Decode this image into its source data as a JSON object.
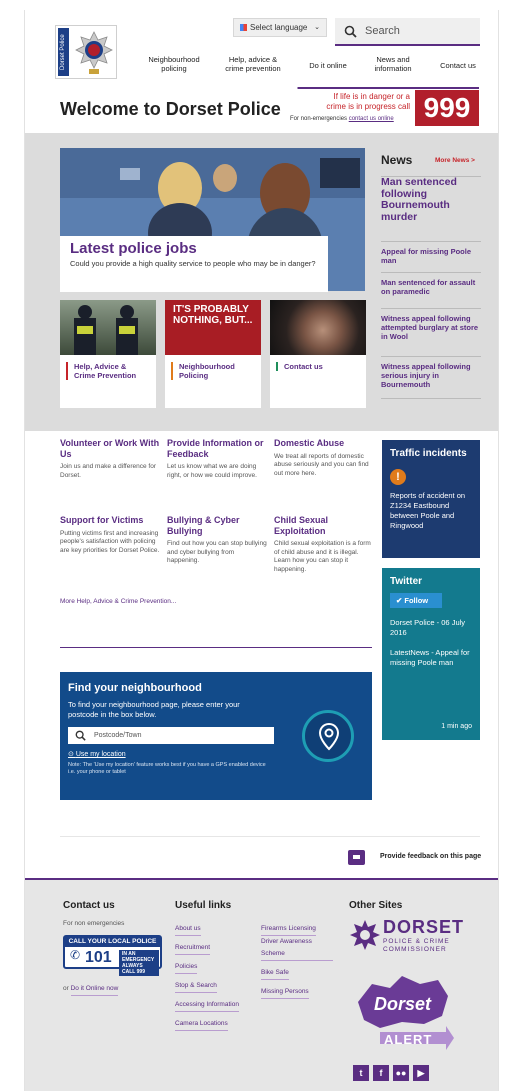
{
  "header": {
    "logo_text": "Dorset Police",
    "language_label": "Select language",
    "search_placeholder": "Search",
    "nav": [
      {
        "label_1": "Neighbourhood",
        "label_2": "policing"
      },
      {
        "label_1": "Help, advice &",
        "label_2": "crime prevention"
      },
      {
        "label_1": "Do it online",
        "label_2": ""
      },
      {
        "label_1": "News and",
        "label_2": "information"
      },
      {
        "label_1": "Contact us",
        "label_2": ""
      }
    ],
    "title": "Welcome to Dorset Police",
    "emergency_line1": "If life is in danger or a",
    "emergency_line2": "crime is in progress call",
    "non_emergency_prefix": "For non-emergencies",
    "non_emergency_link": "contact us online",
    "emergency_number": "999"
  },
  "hero": {
    "title": "Latest police jobs",
    "text": "Could you provide a high quality service to people who may be in danger?"
  },
  "tiles": [
    {
      "label": "Help, Advice & Crime Prevention",
      "accent": "#c6242a"
    },
    {
      "label": "Neighbourhood Policing",
      "image_text": "IT'S PROBABLY NOTHING, BUT...",
      "accent": "#e07b1b"
    },
    {
      "label": "Contact us",
      "accent": "#1f8f5b"
    }
  ],
  "news": {
    "heading": "News",
    "more_label": "More News >",
    "items": [
      "Man sentenced following Bournemouth murder",
      "Appeal for missing Poole man",
      "Man sentenced for assault on paramedic",
      "Witness appeal following attempted burglary at store in Wool",
      "Witness appeal following serious injury in Bournemouth"
    ]
  },
  "links": [
    {
      "title": "Volunteer or Work With Us",
      "text": "Join us and make a difference for Dorset."
    },
    {
      "title": "Provide Information or Feedback",
      "text": "Let us know what we are doing right, or how we could improve."
    },
    {
      "title": "Domestic Abuse",
      "text": "We treat all reports of domestic abuse seriously and you can find out more here."
    },
    {
      "title": "Support for Victims",
      "text": "Putting victims first and increasing people's satisfaction with policing are key priorities for Dorset Police."
    },
    {
      "title": "Bullying & Cyber Bullying",
      "text": "Find out how you can stop bullying and cyber bullying from happening."
    },
    {
      "title": "Child Sexual Exploitation",
      "text": "Child sexual exploitation is a form of child abuse and it is illegal. Learn how you can stop it happening."
    }
  ],
  "more_help_link": "More Help, Advice & Crime Prevention...",
  "traffic": {
    "heading": "Traffic incidents",
    "text": "Reports of accident on Z1234 Eastbound between Poole and Ringwood"
  },
  "twitter": {
    "heading": "Twitter",
    "follow_label": "Follow",
    "author": "Dorset Police - 06 July 2016",
    "tweet": "LatestNews - Appeal for missing Poole man",
    "time": "1 min ago"
  },
  "neighbourhood": {
    "heading": "Find your neighbourhood",
    "text": "To find your neighbourhood page, please enter your postcode in the box below.",
    "placeholder": "Postcode/Town",
    "use_location": "Use my location",
    "note": "Note: The 'Use my location' feature works best if you have a GPS enabled device i.e. your phone or tablet"
  },
  "feedback_label": "Provide feedback on this page",
  "footer": {
    "contact_heading": "Contact us",
    "non_emergencies": "For non emergencies",
    "call_top": "CALL YOUR LOCAL POLICE",
    "call_number": "101",
    "call_note": "IN AN EMERGENCY ALWAYS CALL 999",
    "do_it_online_prefix": "or",
    "do_it_online": "Do it Online now",
    "useful_heading": "Useful links",
    "useful_col1": [
      "About us",
      "Recruitment",
      "Policies",
      "Stop & Search",
      "Accessing Information",
      "Camera Locations"
    ],
    "useful_col2": [
      "Firearms Licensing",
      "Driver Awareness Scheme",
      "Bike Safe",
      "Missing Persons"
    ],
    "other_heading": "Other Sites",
    "dorset_big": "DORSET",
    "dorset_small_1": "POLICE & CRIME",
    "dorset_small_2": "COMMISSIONER",
    "alert_1": "Dorset",
    "alert_2": "ALERT",
    "social": [
      "twitter-icon",
      "facebook-icon",
      "flickr-icon",
      "youtube-icon"
    ]
  }
}
